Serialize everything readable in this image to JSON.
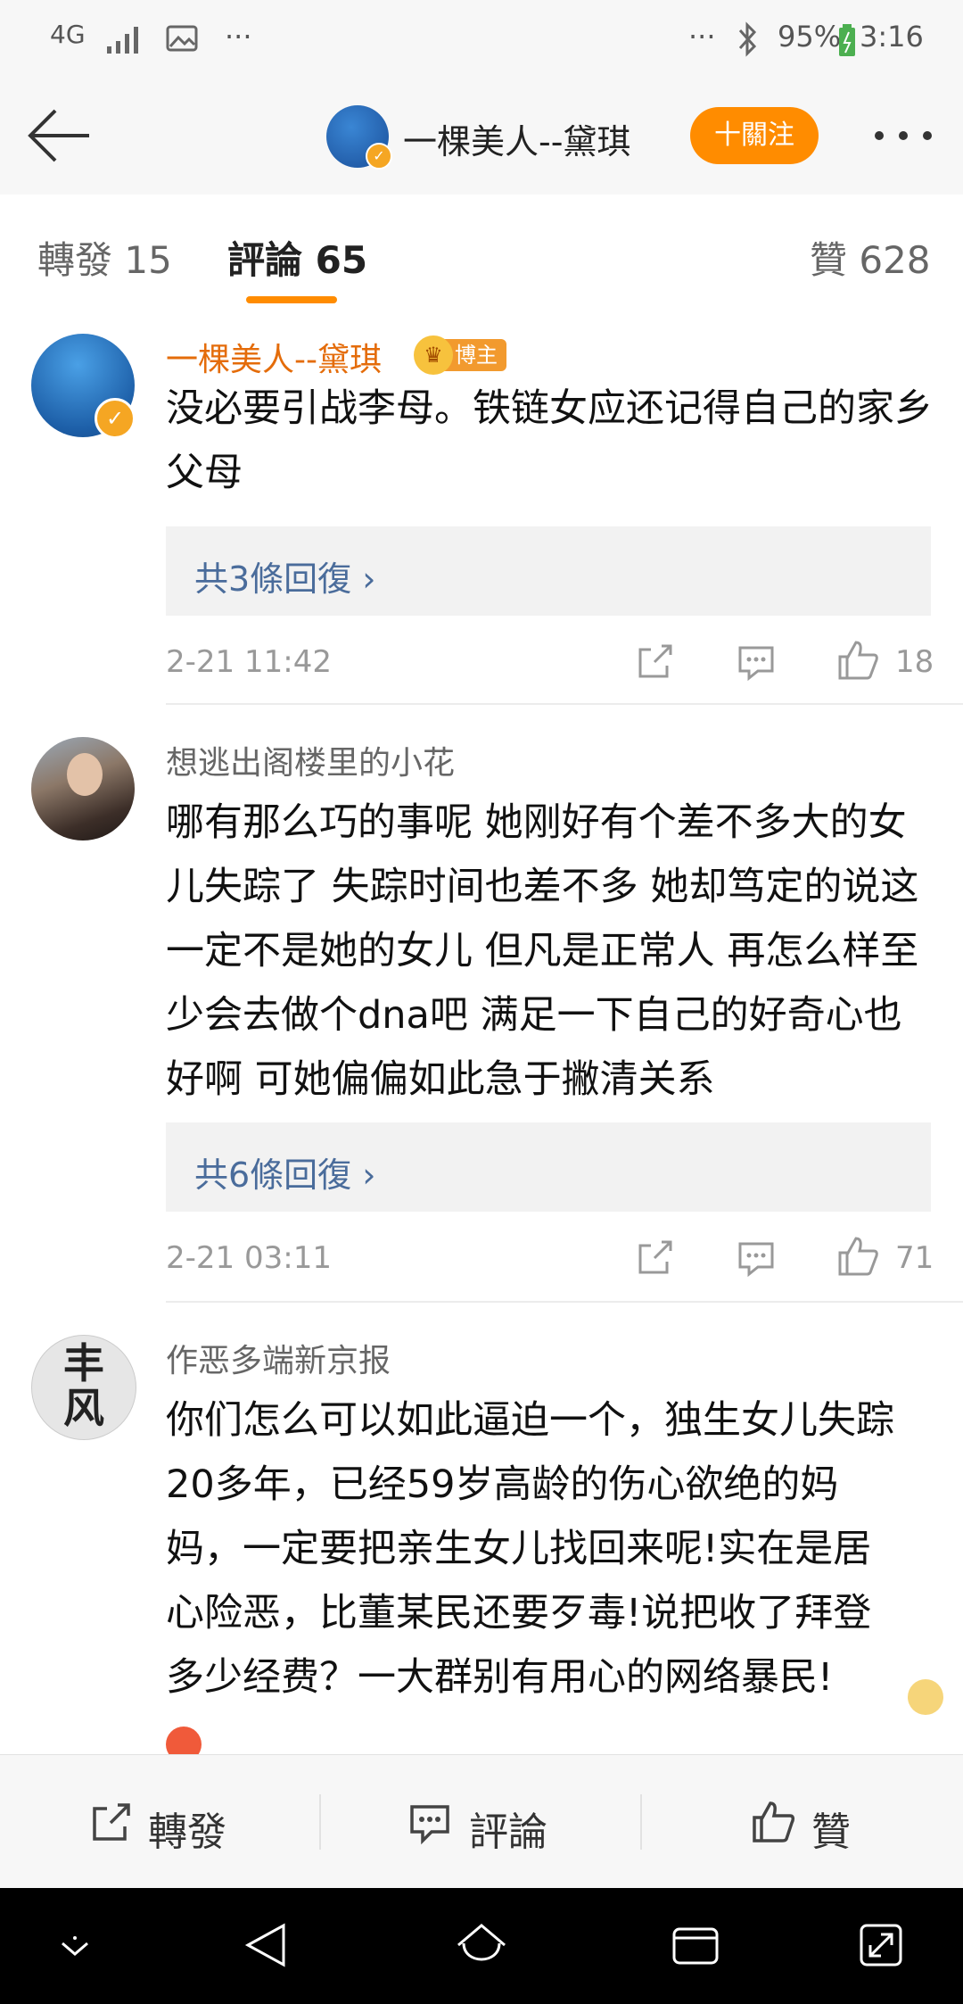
{
  "status_bar": {
    "network": "4G",
    "battery": "95%",
    "time": "3:16",
    "more_left": "···",
    "more_right": "···"
  },
  "top_bar": {
    "title": "一棵美人--黛琪",
    "follow_label": "十關注"
  },
  "tabs": {
    "repost": "轉發 15",
    "comments": "評論 65",
    "likes": "贊 628"
  },
  "comments": [
    {
      "name": "一棵美人--黛琪",
      "badge": "博主",
      "text": "没必要引战李母。铁链女应还记得自己的家乡父母",
      "replies": "共3條回復 ›",
      "time": "2-21 11:42",
      "likes": "18"
    },
    {
      "name": "想逃出阁楼里的小花",
      "text": "哪有那么巧的事呢 她刚好有个差不多大的女儿失踪了 失踪时间也差不多 她却笃定的说这一定不是她的女儿 但凡是正常人 再怎么样至少会去做个dna吧 满足一下自己的好奇心也好啊 可她偏偏如此急于撇清关系",
      "replies": "共6條回復 ›",
      "time": "2-21 03:11",
      "likes": "71"
    },
    {
      "name": "作恶多端新京报",
      "text": "你们怎么可以如此逼迫一个，独生女儿失踪20多年，已经59岁高龄的伤心欲绝的妈妈，一定要把亲生女儿找回来呢!实在是居心险恶，比董某民还要歹毒!说把收了拜登多少经费？一大群别有用心的网络暴民!",
      "avatar_text": "丰风"
    }
  ],
  "action_bar": {
    "repost": "轉發",
    "comment": "評論",
    "like": "贊"
  },
  "colors": {
    "accent": "#ff8c00",
    "link": "#4a6c9b",
    "owner_name": "#e46c0a"
  },
  "icons": [
    "back-arrow-icon",
    "more-dots-icon",
    "share-icon",
    "comment-icon",
    "like-icon",
    "bluetooth-icon",
    "signal-icon",
    "image-icon",
    "battery-icon",
    "nav-down-icon",
    "nav-back-icon",
    "nav-home-icon",
    "nav-recents-icon",
    "nav-expand-icon"
  ]
}
